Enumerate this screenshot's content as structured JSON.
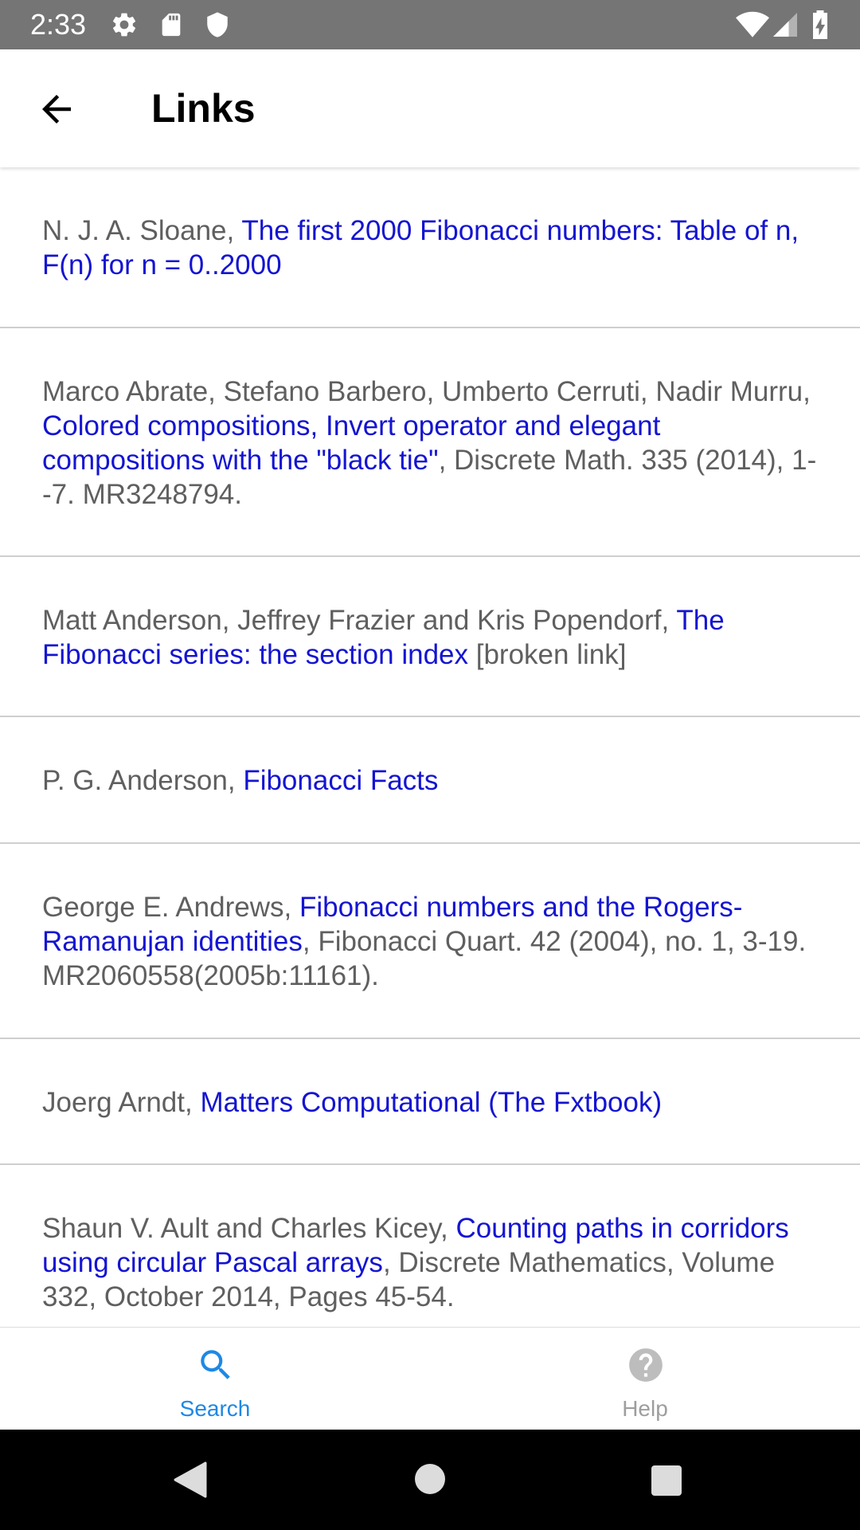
{
  "status_bar": {
    "time": "2:33",
    "left_icons": [
      "gear-icon",
      "sd-card-icon",
      "shield-icon"
    ],
    "right_icons": [
      "wifi-icon",
      "signal-icon",
      "battery-charging-icon"
    ],
    "background": "#757575"
  },
  "app_bar": {
    "title": "Links",
    "back_icon": "arrow-back-icon"
  },
  "links": [
    {
      "prefix": "N. J. A. Sloane, ",
      "link": "The first 2000 Fibonacci numbers: Table of n, F(n) for n = 0..2000",
      "suffix": ""
    },
    {
      "prefix": "Marco Abrate, Stefano Barbero, Umberto Cerruti, Nadir Murru, ",
      "link": "Colored compositions, Invert operator and elegant compositions with the \"black tie\"",
      "suffix": ", Discrete Math. 335 (2014), 1--7. MR3248794."
    },
    {
      "prefix": "Matt Anderson, Jeffrey Frazier and Kris Popendorf, ",
      "link": "The Fibonacci series: the section index",
      "suffix": " [broken link]"
    },
    {
      "prefix": "P. G. Anderson, ",
      "link": "Fibonacci Facts",
      "suffix": ""
    },
    {
      "prefix": "George E. Andrews, ",
      "link": "Fibonacci numbers and the Rogers-Ramanujan identities",
      "suffix": ", Fibonacci Quart. 42 (2004), no. 1, 3-19. MR2060558(2005b:11161)."
    },
    {
      "prefix": "Joerg Arndt, ",
      "link": "Matters Computational (The Fxtbook)",
      "suffix": ""
    },
    {
      "prefix": "Shaun V. Ault and Charles Kicey, ",
      "link": "Counting paths in corridors using circular Pascal arrays",
      "suffix": ", Discrete Mathematics, Volume 332, October 2014, Pages 45-54."
    }
  ],
  "bottom_nav": {
    "items": [
      {
        "label": "Search",
        "icon": "search-icon",
        "active": true
      },
      {
        "label": "Help",
        "icon": "help-icon",
        "active": false
      }
    ],
    "active_color": "#1e88e5",
    "inactive_color": "#9e9e9e"
  },
  "system_nav": [
    "back-triangle-icon",
    "home-circle-icon",
    "recents-square-icon"
  ],
  "colors": {
    "link": "#1414d2",
    "text": "#5f5f5f",
    "divider": "#cfcfcf"
  }
}
